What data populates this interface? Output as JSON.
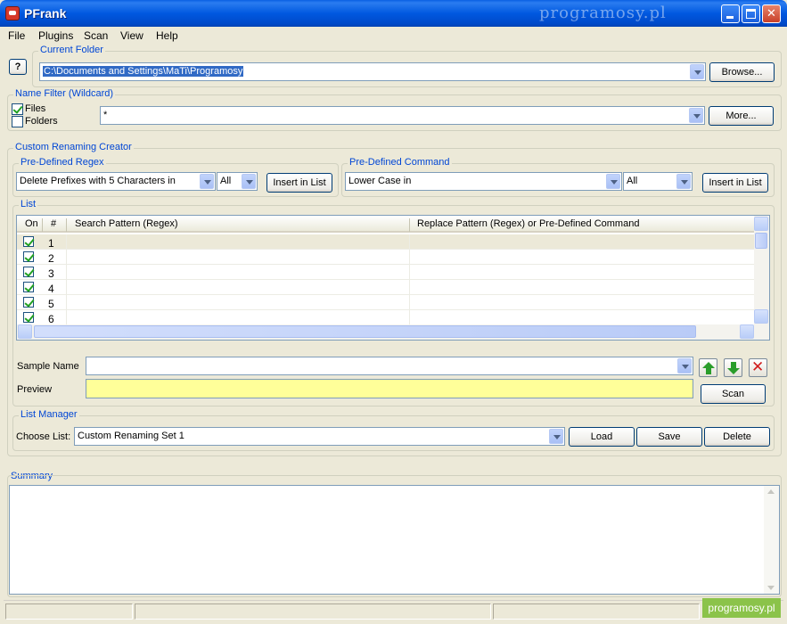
{
  "window": {
    "title": "PFrank",
    "watermark": "programosy.pl"
  },
  "menu": [
    "File",
    "Plugins",
    "Scan",
    "View",
    "Help"
  ],
  "current_folder": {
    "label": "Current Folder",
    "help_button": "?",
    "path": "C:\\Documents and Settings\\MaTi\\Programosy",
    "browse_button": "Browse..."
  },
  "name_filter": {
    "label": "Name Filter (Wildcard)",
    "files_label": "Files",
    "files_checked": true,
    "folders_label": "Folders",
    "folders_checked": false,
    "pattern": "*",
    "more_button": "More..."
  },
  "renaming_creator": {
    "label": "Custom Renaming Creator",
    "regex": {
      "label": "Pre-Defined Regex",
      "selected": "Delete Prefixes with 5 Characters in",
      "scope": "All",
      "insert_button": "Insert in List"
    },
    "command": {
      "label": "Pre-Defined Command",
      "selected": "Lower Case in",
      "scope": "All",
      "insert_button": "Insert in List"
    },
    "list": {
      "label": "List",
      "columns": [
        "On",
        "#",
        "Search Pattern (Regex)",
        "Replace Pattern (Regex)  or  Pre-Defined Command"
      ],
      "rows": [
        {
          "on": true,
          "num": "1"
        },
        {
          "on": true,
          "num": "2"
        },
        {
          "on": true,
          "num": "3"
        },
        {
          "on": true,
          "num": "4"
        },
        {
          "on": true,
          "num": "5"
        },
        {
          "on": true,
          "num": "6"
        }
      ]
    },
    "sample_name_label": "Sample Name",
    "sample_name_value": "",
    "preview_label": "Preview",
    "preview_value": "",
    "scan_button": "Scan",
    "colors": {
      "preview_bg": "#ffff99"
    }
  },
  "list_manager": {
    "label": "List Manager",
    "choose_label": "Choose List:",
    "selected": "Custom Renaming Set 1",
    "load_button": "Load",
    "save_button": "Save",
    "delete_button": "Delete"
  },
  "summary": {
    "label": "Summary",
    "text": ""
  },
  "status_badge": "programosy.pl",
  "colors": {
    "titlebar": "#0058e0",
    "group_label": "#0046d5",
    "window_bg": "#ece9d8"
  }
}
